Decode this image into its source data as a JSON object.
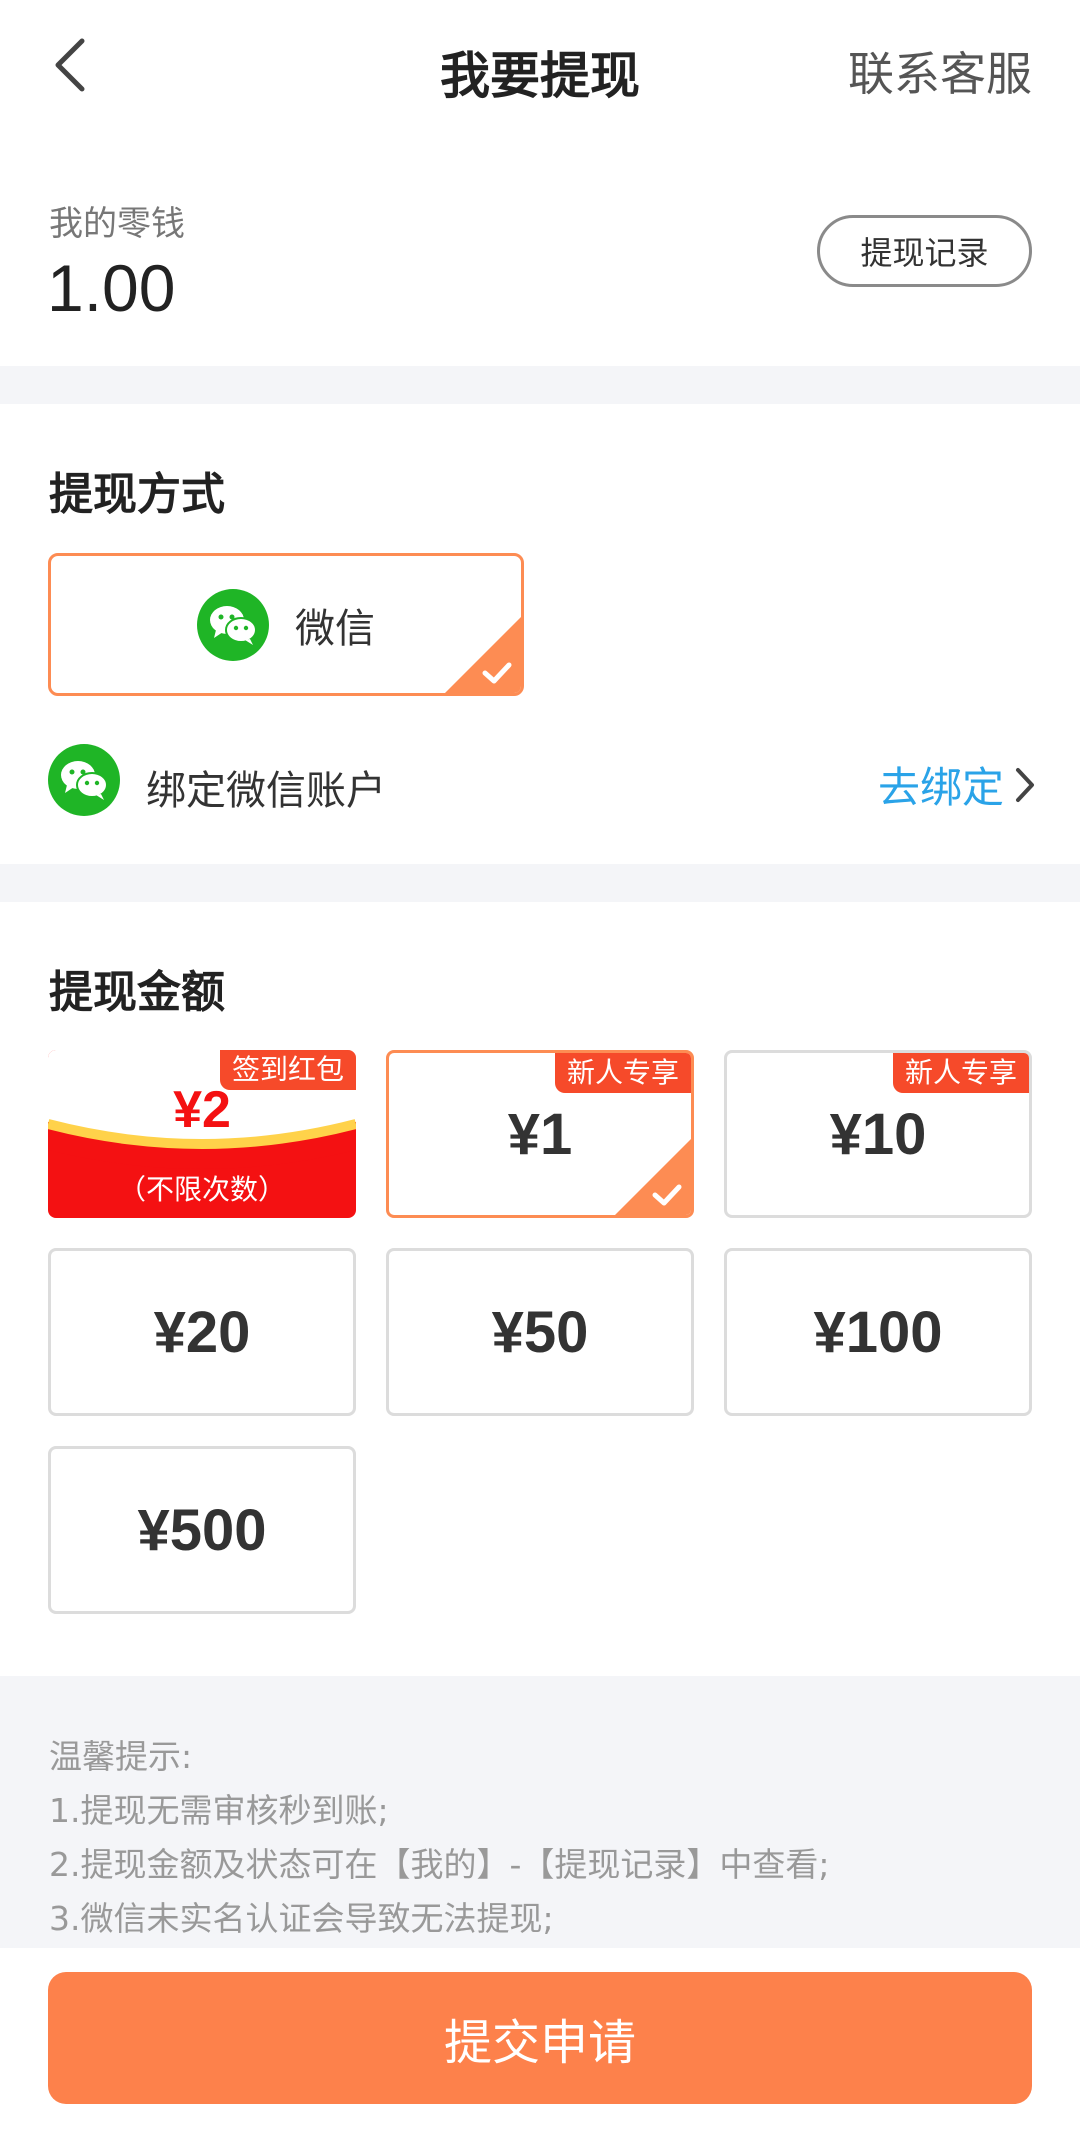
{
  "header": {
    "title": "我要提现",
    "contact_label": "联系客服"
  },
  "balance": {
    "label": "我的零钱",
    "value": "1.00",
    "records_label": "提现记录"
  },
  "method": {
    "section_title": "提现方式",
    "option_label": "微信",
    "selected": true,
    "bind_label": "绑定微信账户",
    "bind_link": "去绑定"
  },
  "amount": {
    "section_title": "提现金额",
    "redpack": {
      "tag": "签到红包",
      "value": "¥2",
      "subtitle": "（不限次数）"
    },
    "options": [
      {
        "value": "¥1",
        "tag": "新人专享",
        "selected": true
      },
      {
        "value": "¥10",
        "tag": "新人专享",
        "selected": false
      },
      {
        "value": "¥20",
        "tag": "",
        "selected": false
      },
      {
        "value": "¥50",
        "tag": "",
        "selected": false
      },
      {
        "value": "¥100",
        "tag": "",
        "selected": false
      },
      {
        "value": "¥500",
        "tag": "",
        "selected": false
      }
    ]
  },
  "tips": {
    "title": "温馨提示:",
    "lines": [
      "1.提现无需审核秒到账;",
      "2.提现金额及状态可在【我的】-【提现记录】中查看;",
      "3.微信未实名认证会导致无法提现;"
    ]
  },
  "submit_label": "提交申请",
  "colors": {
    "accent": "#fd8c53",
    "button": "#fd814b",
    "wechat_green": "#1fb526",
    "link_blue": "#2aa3e8",
    "tag_red": "#f64a2a",
    "redpack_red": "#f41112",
    "gap_gray": "#f4f5f8"
  }
}
